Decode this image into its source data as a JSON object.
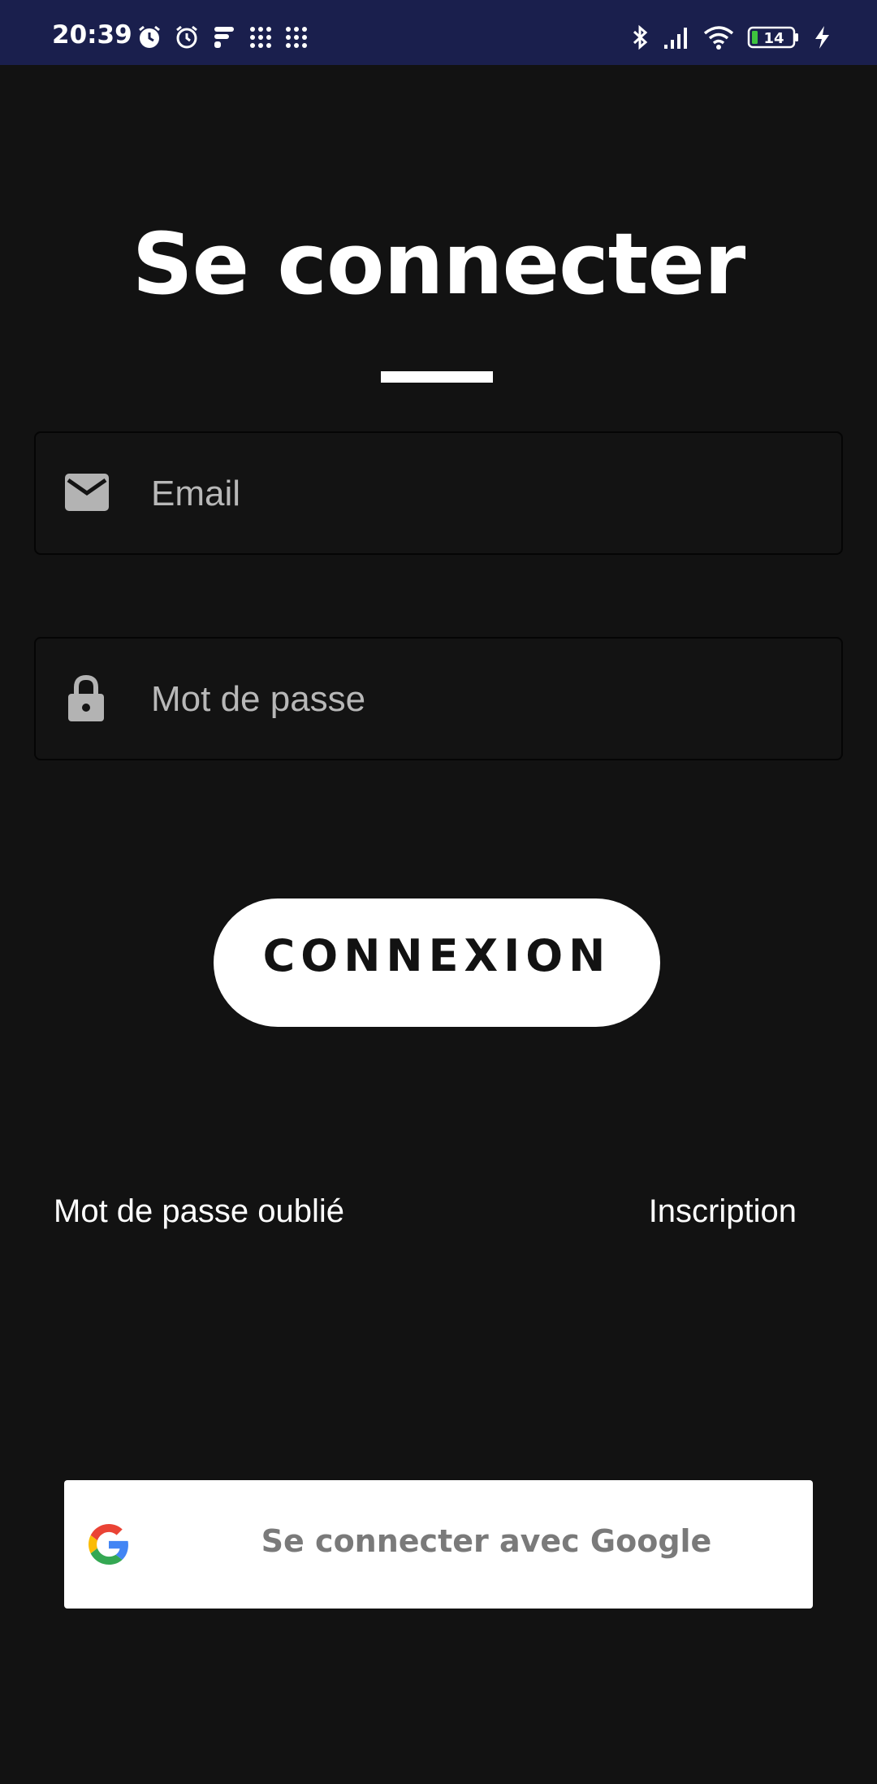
{
  "status_bar": {
    "time": "20:39",
    "battery_level": "14",
    "left_icons": [
      "alarm-icon",
      "alarm-clock-icon",
      "app-notification-icon",
      "grid-app-icon",
      "grid-app-icon"
    ],
    "right_icons": [
      "bluetooth-icon",
      "signal-icon",
      "wifi-icon",
      "battery-icon",
      "charging-icon"
    ]
  },
  "login": {
    "title": "Se connecter",
    "email_placeholder": "Email",
    "password_placeholder": "Mot de passe",
    "submit_label": "CONNEXION",
    "forgot_password_label": "Mot de passe oublié",
    "register_label": "Inscription",
    "google_button_label": "Se connecter avec Google"
  },
  "colors": {
    "background": "#121212",
    "status_bar": "#1a1f4d",
    "primary_button": "#ffffff",
    "google_text": "#7a7a7a"
  }
}
